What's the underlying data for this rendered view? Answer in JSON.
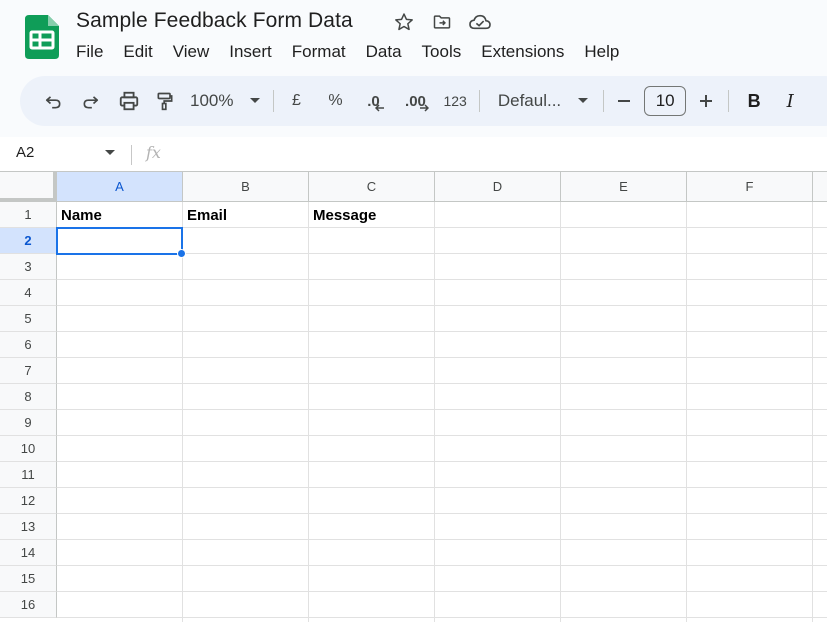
{
  "app": {
    "title": "Sample Feedback Form Data",
    "accent_color": "#0f9d58",
    "selection_color": "#1a73e8"
  },
  "menu": [
    "File",
    "Edit",
    "View",
    "Insert",
    "Format",
    "Data",
    "Tools",
    "Extensions",
    "Help"
  ],
  "toolbar": {
    "zoom": "100%",
    "currency": "£",
    "percent": "%",
    "dec_decrease": ".0",
    "dec_increase": ".00",
    "number_format": "123",
    "font": "Defaul...",
    "font_size": "10",
    "bold": "B",
    "italic": "I"
  },
  "formula_bar": {
    "cell_ref": "A2",
    "fx": "fx"
  },
  "sheet": {
    "columns": [
      "A",
      "B",
      "C",
      "D",
      "E",
      "F"
    ],
    "rows": [
      "1",
      "2",
      "3",
      "4",
      "5",
      "6",
      "7",
      "8",
      "9",
      "10",
      "11",
      "12",
      "13",
      "14",
      "15",
      "16"
    ],
    "headers": {
      "A1": "Name",
      "B1": "Email",
      "C1": "Message"
    },
    "selected_cell": "A2"
  }
}
